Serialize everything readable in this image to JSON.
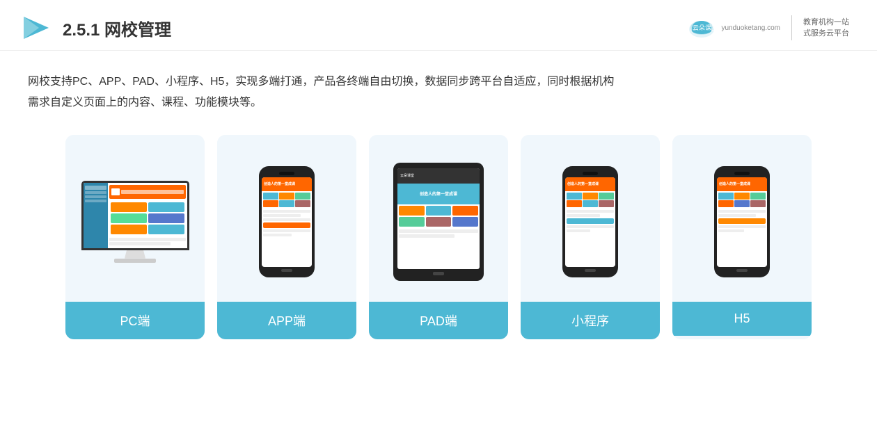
{
  "header": {
    "title_prefix": "2.5.1 ",
    "title_bold": "网校管理",
    "brand": {
      "name": "云朵课堂",
      "url": "yunduoketang.com",
      "slogan_line1": "教育机构一站",
      "slogan_line2": "式服务云平台"
    }
  },
  "description": {
    "text_line1": "网校支持PC、APP、PAD、小程序、H5，实现多端打通，产品各终端自由切换，数据同步跨平台自适应，同时根据机构",
    "text_line2": "需求自定义页面上的内容、课程、功能模块等。"
  },
  "cards": [
    {
      "id": "pc",
      "label": "PC端",
      "type": "pc"
    },
    {
      "id": "app",
      "label": "APP端",
      "type": "phone"
    },
    {
      "id": "pad",
      "label": "PAD端",
      "type": "pad"
    },
    {
      "id": "miniprogram",
      "label": "小程序",
      "type": "phone"
    },
    {
      "id": "h5",
      "label": "H5",
      "type": "phone"
    }
  ],
  "colors": {
    "teal": "#4db8d4",
    "orange": "#f60",
    "bg_card": "#f0f7fc",
    "text_main": "#333"
  }
}
